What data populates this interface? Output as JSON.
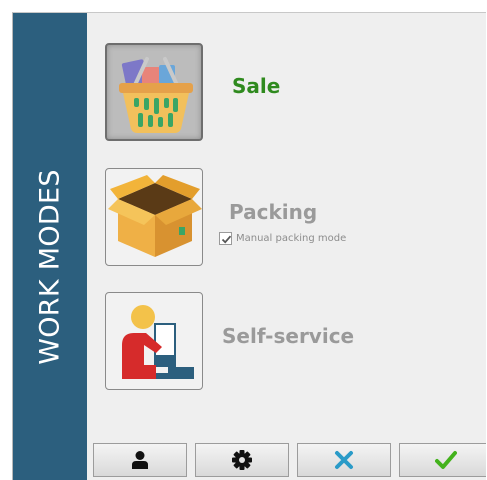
{
  "sidebar": {
    "title": "WORK MODES"
  },
  "modes": [
    {
      "id": "sale",
      "label": "Sale",
      "icon": "shopping-basket-icon",
      "selected": true
    },
    {
      "id": "packing",
      "label": "Packing",
      "icon": "open-box-icon",
      "selected": false,
      "option": {
        "label": "Manual packing mode",
        "checked": true
      }
    },
    {
      "id": "self-service",
      "label": "Self-service",
      "icon": "self-service-kiosk-icon",
      "selected": false
    }
  ],
  "footer": {
    "buttons": [
      {
        "id": "user",
        "icon": "user-icon"
      },
      {
        "id": "settings",
        "icon": "gear-icon"
      },
      {
        "id": "cancel",
        "icon": "close-icon",
        "color": "#2a9bc8"
      },
      {
        "id": "confirm",
        "icon": "checkmark-icon",
        "color": "#43b21c"
      }
    ]
  },
  "colors": {
    "sidebar": "#2c5f7e",
    "active_label": "#2f8a1e",
    "inactive_label": "#9a9a9a",
    "background": "#efefef"
  }
}
